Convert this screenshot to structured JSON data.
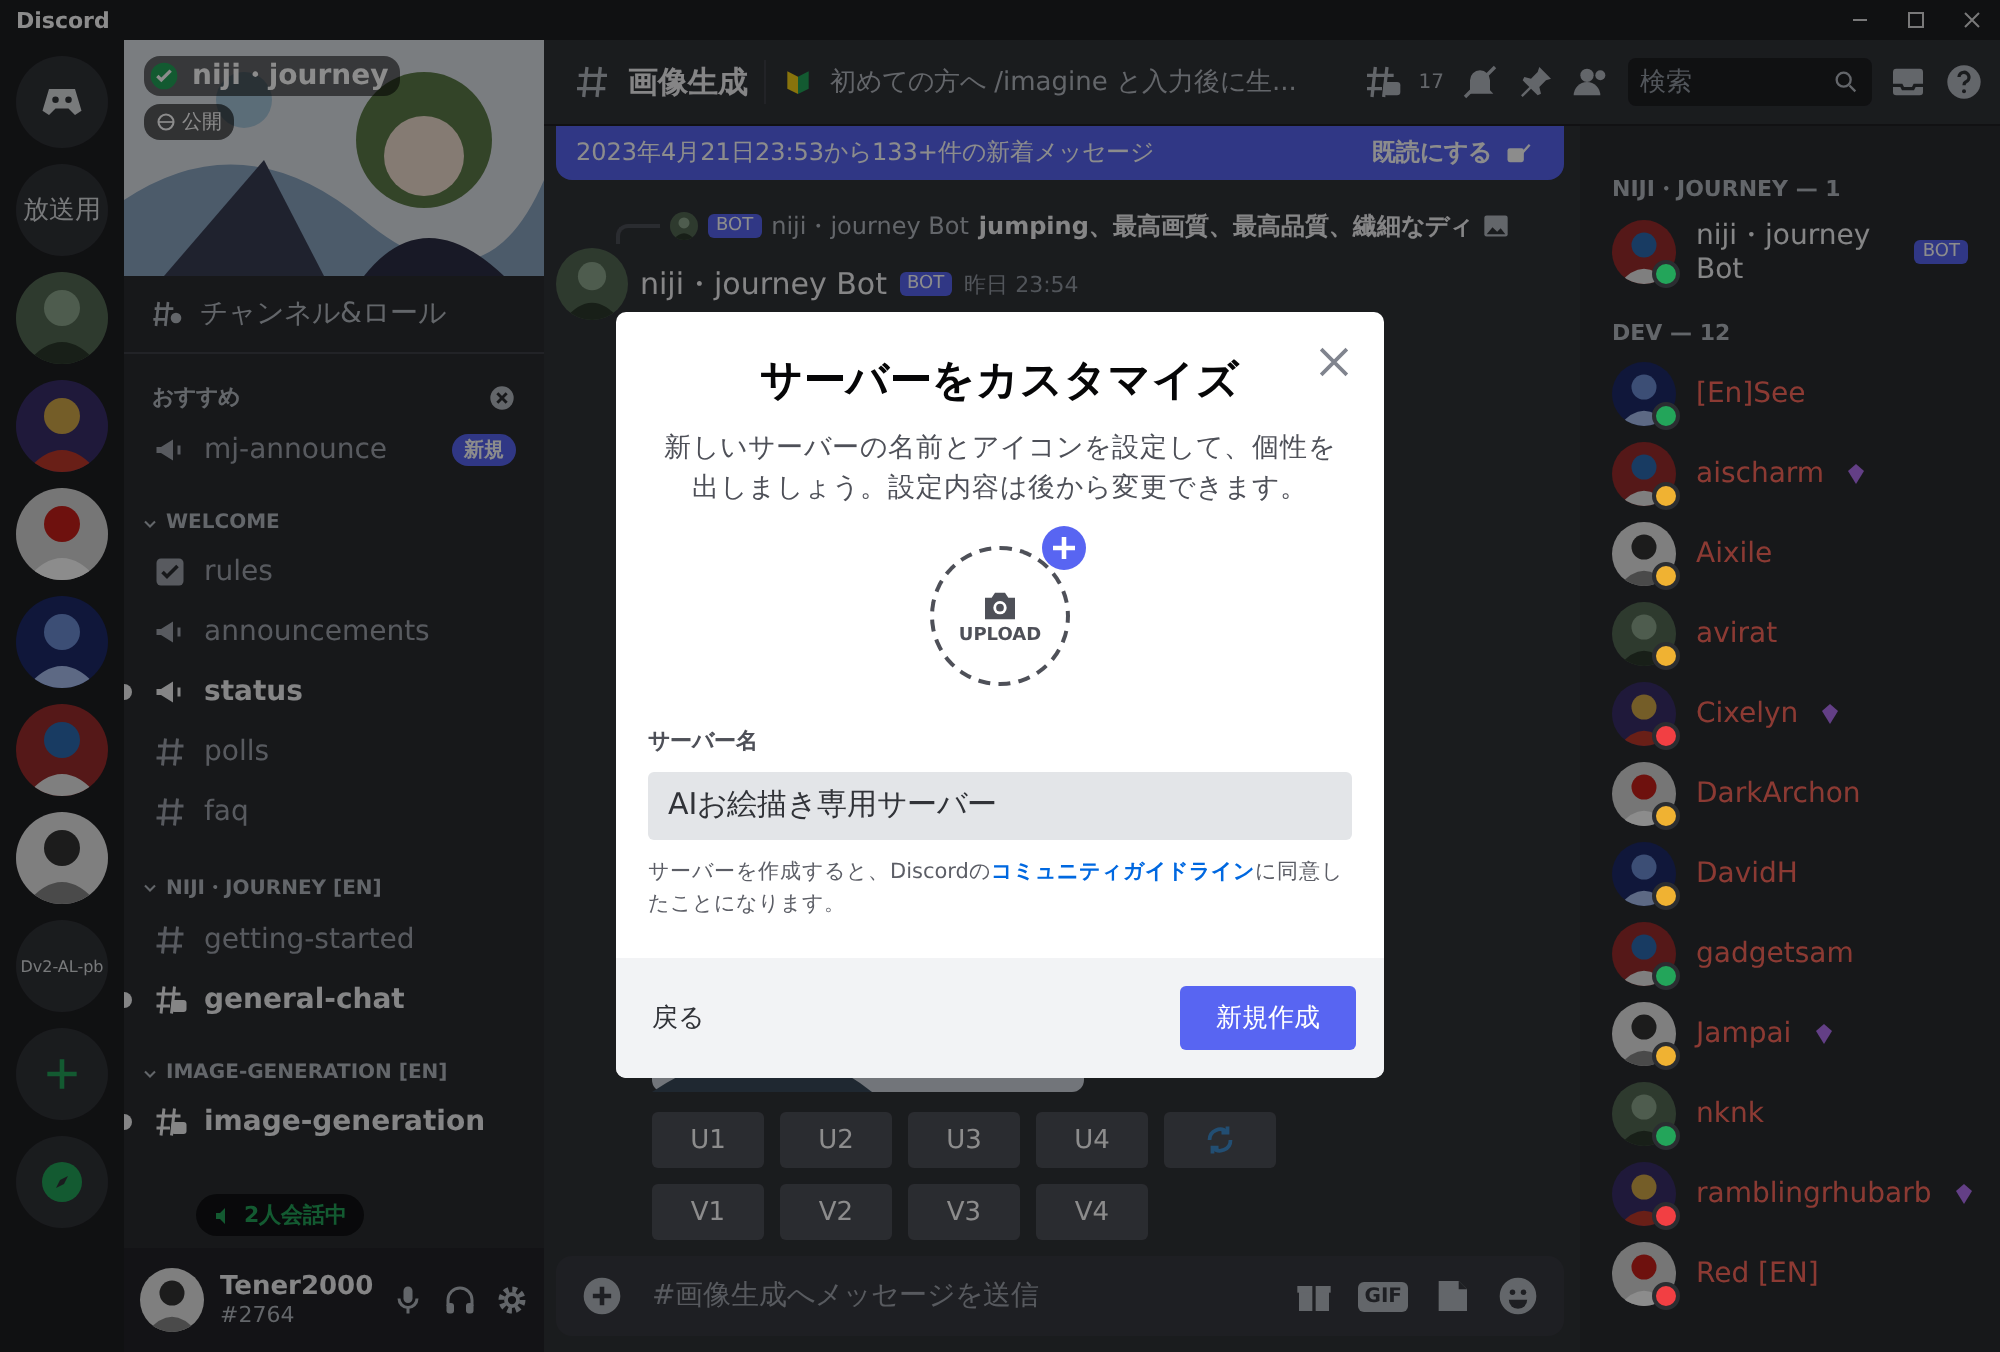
{
  "window": {
    "title": "Discord"
  },
  "servers": [
    {
      "kind": "home"
    },
    {
      "kind": "text",
      "label": "放送用"
    },
    {
      "kind": "picture"
    },
    {
      "kind": "picture"
    },
    {
      "kind": "picture"
    },
    {
      "kind": "picture"
    },
    {
      "kind": "picture"
    },
    {
      "kind": "picture"
    },
    {
      "kind": "text",
      "label": "Dv2-AL-pb"
    },
    {
      "kind": "add"
    },
    {
      "kind": "explore"
    }
  ],
  "server": {
    "name": "niji・journey",
    "badge": "公開",
    "roles_link": "チャンネル&ロール"
  },
  "recommended": {
    "title": "おすすめ",
    "channels": [
      {
        "name": "mj-announce",
        "kind": "announcement",
        "badge": "新規",
        "unread": false
      }
    ]
  },
  "categories": [
    {
      "name": "WELCOME",
      "channels": [
        {
          "name": "rules",
          "kind": "rules",
          "unread": false
        },
        {
          "name": "announcements",
          "kind": "announcement",
          "unread": false
        },
        {
          "name": "status",
          "kind": "announcement",
          "unread": true
        },
        {
          "name": "polls",
          "kind": "text",
          "unread": false
        },
        {
          "name": "faq",
          "kind": "text",
          "unread": false
        }
      ]
    },
    {
      "name": "NIJI・JOURNEY [EN]",
      "channels": [
        {
          "name": "getting-started",
          "kind": "text",
          "unread": false
        },
        {
          "name": "general-chat",
          "kind": "thread",
          "unread": true
        }
      ]
    },
    {
      "name": "IMAGE-GENERATION [EN]",
      "channels": [
        {
          "name": "image-generation",
          "kind": "thread",
          "unread": true
        }
      ]
    }
  ],
  "voice_pill": "2人会話中",
  "user": {
    "name": "Tener2000",
    "tag": "#2764"
  },
  "header": {
    "channel": "画像生成",
    "topic": "初めての方へ /imagine と入力後に生...",
    "thread_count": "17",
    "search_placeholder": "検索"
  },
  "new_messages": {
    "text": "2023年4月21日23:53から133+件の新着メッセージ",
    "action": "既読にする"
  },
  "message": {
    "reply": {
      "bot_tag": "BOT",
      "author": "niji・journey Bot",
      "text": "jumping、最高画質、最高品質、繊細なディ"
    },
    "author": "niji・journey Bot",
    "bot_tag": "BOT",
    "time": "昨日 23:54"
  },
  "action_rows": [
    [
      {
        "kind": "text",
        "label": "U1"
      },
      {
        "kind": "text",
        "label": "U2"
      },
      {
        "kind": "text",
        "label": "U3"
      },
      {
        "kind": "text",
        "label": "U4"
      },
      {
        "kind": "refresh"
      }
    ],
    [
      {
        "kind": "text",
        "label": "V1"
      },
      {
        "kind": "text",
        "label": "V2"
      },
      {
        "kind": "text",
        "label": "V3"
      },
      {
        "kind": "text",
        "label": "V4"
      }
    ]
  ],
  "composer": {
    "placeholder": "#画像生成へメッセージを送信",
    "gif": "GIF"
  },
  "member_groups": [
    {
      "title": "NIJI・JOURNEY — 1",
      "members": [
        {
          "name": "niji・journey Bot",
          "bot": true,
          "bot_tag": "BOT",
          "color": "#23a55a",
          "boost": false
        }
      ]
    },
    {
      "title": "DEV — 12",
      "members": [
        {
          "name": "[En]See",
          "bot": false,
          "color": "#23a55a",
          "boost": false
        },
        {
          "name": "aischarm",
          "bot": false,
          "color": "#f0b232",
          "boost": true
        },
        {
          "name": "Aixile",
          "bot": false,
          "color": "#f0b232",
          "boost": false
        },
        {
          "name": "avirat",
          "bot": false,
          "color": "#f0b232",
          "boost": false
        },
        {
          "name": "Cixelyn",
          "bot": false,
          "color": "#f23f43",
          "boost": true
        },
        {
          "name": "DarkArchon",
          "bot": false,
          "color": "#f0b232",
          "boost": false
        },
        {
          "name": "DavidH",
          "bot": false,
          "color": "#f0b232",
          "boost": false
        },
        {
          "name": "gadgetsam",
          "bot": false,
          "color": "#23a55a",
          "boost": false
        },
        {
          "name": "Jampai",
          "bot": false,
          "color": "#f0b232",
          "boost": true
        },
        {
          "name": "nknk",
          "bot": false,
          "color": "#23a55a",
          "boost": false
        },
        {
          "name": "ramblingrhubarb",
          "bot": false,
          "color": "#f23f43",
          "boost": true
        },
        {
          "name": "Red [EN]",
          "bot": false,
          "color": "#f23f43",
          "boost": false
        }
      ]
    }
  ],
  "dialog": {
    "title": "サーバーをカスタマイズ",
    "description": "新しいサーバーの名前とアイコンを設定して、個性を出しましょう。設定内容は後から変更できます。",
    "upload_label": "UPLOAD",
    "field_label": "サーバー名",
    "field_value": "AIお絵描き専用サーバー",
    "note_before": "サーバーを作成すると、Discordの",
    "note_link": "コミュニティガイドライン",
    "note_after": "に同意したことになります。",
    "back": "戻る",
    "create": "新規作成"
  }
}
